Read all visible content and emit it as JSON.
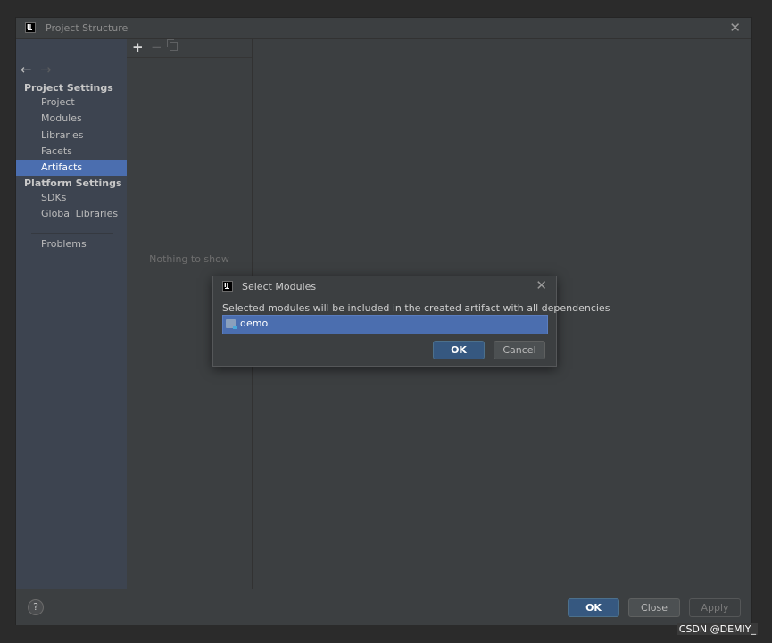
{
  "window": {
    "title": "Project Structure",
    "close_glyph": "✕",
    "icon": "intellij-logo-icon",
    "logo_text": "IJ"
  },
  "nav": {
    "back_glyph": "←",
    "forward_glyph": "→"
  },
  "sidebar": {
    "project_settings_header": "Project Settings",
    "platform_settings_header": "Platform Settings",
    "items": [
      {
        "label": "Project"
      },
      {
        "label": "Modules"
      },
      {
        "label": "Libraries"
      },
      {
        "label": "Facets"
      },
      {
        "label": "Artifacts",
        "selected": true
      },
      {
        "label": "SDKs"
      },
      {
        "label": "Global Libraries"
      },
      {
        "label": "Problems"
      }
    ]
  },
  "artifacts_panel": {
    "add_glyph": "+",
    "remove_glyph": "−",
    "empty_text": "Nothing to show"
  },
  "footer": {
    "help_glyph": "?",
    "ok_label": "OK",
    "close_label": "Close",
    "apply_label": "Apply"
  },
  "dialog": {
    "title": "Select Modules",
    "close_glyph": "✕",
    "logo_text": "IJ",
    "description": "Selected modules will be included in the created artifact with all dependencies",
    "modules": [
      {
        "label": "demo",
        "selected": true
      }
    ],
    "ok_label": "OK",
    "cancel_label": "Cancel"
  },
  "watermark": "CSDN @DEMIY_",
  "colors": {
    "selection": "#4b6eaf",
    "primary_button": "#365880",
    "background": "#3c3f41"
  }
}
